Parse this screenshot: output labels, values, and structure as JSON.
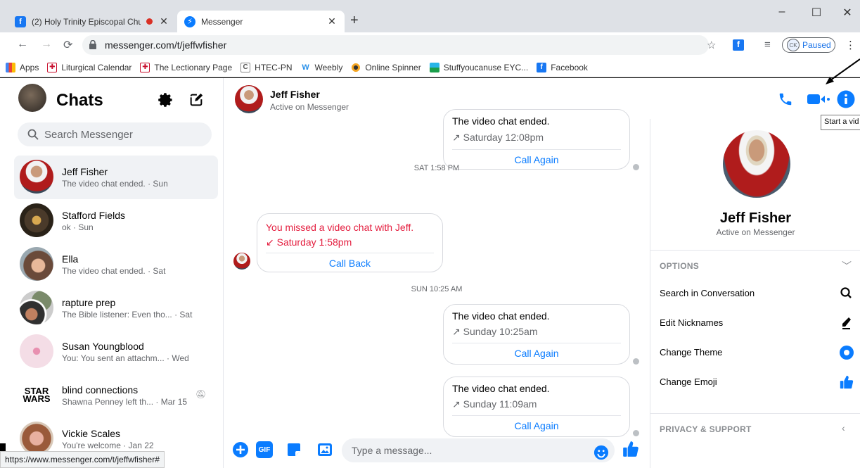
{
  "browser": {
    "tabs": [
      {
        "title": "(2) Holy Trinity Episcopal Chu",
        "favicon": "facebook-icon",
        "recording": true
      },
      {
        "title": "Messenger",
        "favicon": "messenger-icon",
        "active": true
      }
    ],
    "url": "messenger.com/t/jeffwfisher",
    "profile_label": "Paused",
    "bookmarks": [
      {
        "label": "Apps",
        "icon": "apps-grid-icon"
      },
      {
        "label": "Liturgical Calendar",
        "icon": "episcopal-shield-icon"
      },
      {
        "label": "The Lectionary Page",
        "icon": "episcopal-shield-icon"
      },
      {
        "label": "HTEC-PN",
        "icon": "htec-icon"
      },
      {
        "label": "Weebly",
        "icon": "weebly-icon"
      },
      {
        "label": "Online Spinner",
        "icon": "spinner-icon"
      },
      {
        "label": "Stuffyoucanuse EYC...",
        "icon": "stuff-icon"
      },
      {
        "label": "Facebook",
        "icon": "facebook-icon"
      }
    ],
    "status_url": "https://www.messenger.com/t/jeffwfisher#"
  },
  "sidebar": {
    "title": "Chats",
    "search_placeholder": "Search Messenger",
    "conversations": [
      {
        "name": "Jeff Fisher",
        "preview": "The video chat ended. · Sun",
        "selected": true
      },
      {
        "name": "Stafford Fields",
        "preview": "ok · Sun"
      },
      {
        "name": "Ella",
        "preview": "The video chat ended. · Sat"
      },
      {
        "name": "rapture prep",
        "preview": "The Bible listener: Even tho... · Sat"
      },
      {
        "name": "Susan Youngblood",
        "preview": "You: You sent an attachm... · Wed"
      },
      {
        "name": "blind connections",
        "preview": "Shawna Penney left th... · Mar 15",
        "muted": true
      },
      {
        "name": "Vickie Scales",
        "preview": "You're welcome · Jan 22"
      }
    ]
  },
  "conversation": {
    "name": "Jeff Fisher",
    "status": "Active on Messenger",
    "messages": [
      {
        "title": "The video chat ended.",
        "time": "↗ Saturday 12:08pm",
        "action": "Call Again"
      },
      {
        "separator": "SAT 1:58 PM"
      },
      {
        "title": "You missed a video chat with Jeff.",
        "time": "↙ Saturday 1:58pm",
        "action": "Call Back"
      },
      {
        "separator": "SUN 10:25 AM"
      },
      {
        "title": "The video chat ended.",
        "time": "↗ Sunday 10:25am",
        "action": "Call Again"
      },
      {
        "title": "The video chat ended.",
        "time": "↗ Sunday 11:09am",
        "action": "Call Again"
      }
    ],
    "composer_placeholder": "Type a message...",
    "gif_label": "GIF"
  },
  "info_pane": {
    "name": "Jeff Fisher",
    "status": "Active on Messenger",
    "options_header": "OPTIONS",
    "options": [
      {
        "label": "Search in Conversation",
        "icon": "search-icon"
      },
      {
        "label": "Edit Nicknames",
        "icon": "pencil-icon"
      },
      {
        "label": "Change Theme",
        "icon": "theme-dot-icon"
      },
      {
        "label": "Change Emoji",
        "icon": "thumbs-up-icon"
      }
    ],
    "privacy_header": "PRIVACY & SUPPORT"
  },
  "tooltip": "Start a vid",
  "colors": {
    "accent": "#0a7cff",
    "missed": "#e41e3f",
    "chrome": "#dee1e6"
  }
}
